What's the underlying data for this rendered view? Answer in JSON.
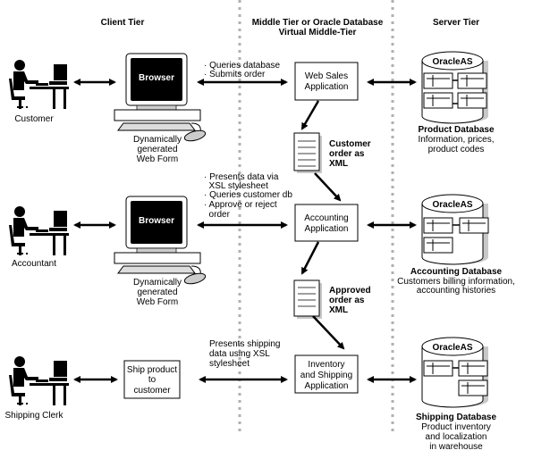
{
  "headers": {
    "client": "Client Tier",
    "middle_line1": "Middle Tier or Oracle Database",
    "middle_line2": "Virtual Middle-Tier",
    "server": "Server Tier"
  },
  "rows": [
    {
      "actor": "Customer",
      "client_label": "Browser",
      "client_caption": [
        "Dynamically",
        "generated",
        "Web Form"
      ],
      "link_notes": [
        "· Queries database",
        "· Submits order"
      ],
      "app": [
        "Web Sales",
        "Application"
      ],
      "db_brand": "OracleAS",
      "db_title": "Product Database",
      "db_desc": [
        "Information, prices,",
        "product codes"
      ],
      "doc_label": [
        "Customer",
        "order as",
        "XML"
      ]
    },
    {
      "actor": "Accountant",
      "client_label": "Browser",
      "client_caption": [
        "Dynamically",
        "generated",
        "Web Form"
      ],
      "link_notes": [
        "· Presents data via",
        "  XSL stylesheet",
        "· Queries customer db",
        "· Approve or reject",
        "  order"
      ],
      "app": [
        "Accounting",
        "Application"
      ],
      "db_brand": "OracleAS",
      "db_title": "Accounting Database",
      "db_desc": [
        "Customers billing information,",
        "accounting histories"
      ],
      "doc_label": [
        "Approved",
        "order as",
        "XML"
      ]
    },
    {
      "actor": "Shipping Clerk",
      "client_box": [
        "Ship product",
        "to",
        "customer"
      ],
      "link_notes": [
        "Presents shipping",
        "data using XSL",
        "stylesheet"
      ],
      "app": [
        "Inventory",
        "and Shipping",
        "Application"
      ],
      "db_brand": "OracleAS",
      "db_title": "Shipping Database",
      "db_desc": [
        "Product inventory",
        "and localization",
        "in warehouse"
      ]
    }
  ],
  "colors": {
    "line": "#000000",
    "divider": "#b0b0b0",
    "shadow": "#c8c8c8"
  }
}
